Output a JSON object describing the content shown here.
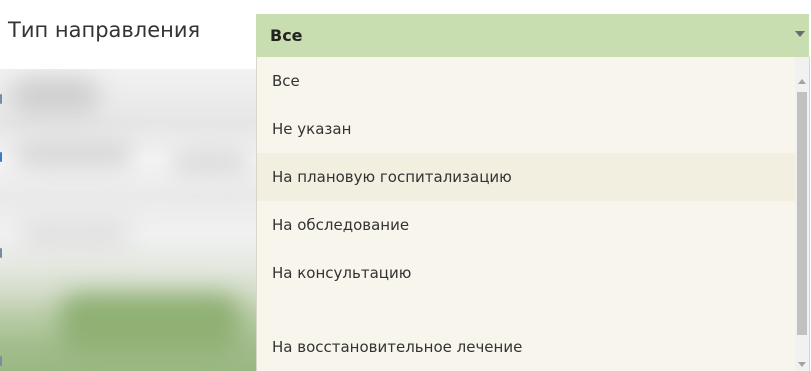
{
  "field": {
    "label": "Тип направления",
    "selected_value": "Все"
  },
  "dropdown": {
    "options": [
      "Все",
      "Не указан",
      "На плановую госпитализацию",
      "На обследование",
      "На консультацию",
      "На восстановительное лечение"
    ]
  },
  "icons": {
    "select_arrow": "chevron-down-icon",
    "scroll_up": "scroll-up-arrow-icon",
    "scroll_down": "scroll-down-arrow-icon"
  },
  "colors": {
    "select_background": "#c8ddb0",
    "dropdown_background": "#f7f5ec",
    "option_hover": "#f2eee0",
    "text": "#333333"
  }
}
